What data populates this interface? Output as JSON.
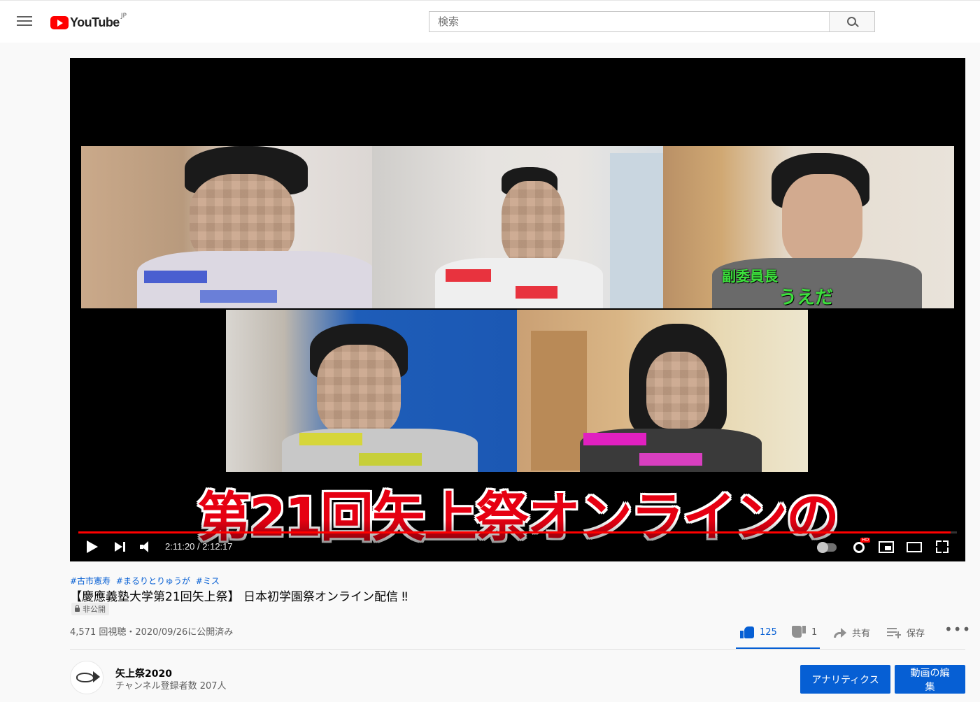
{
  "header": {
    "logo_text": "YouTube",
    "logo_region": "JP",
    "search_placeholder": "検索"
  },
  "player": {
    "overlay_labels": [
      "副委員長",
      "うえだ"
    ],
    "caption": "第21回矢上祭オンラインの",
    "time": "2:11:20 / 2:12:17",
    "progress_fraction": 0.993,
    "hd_badge": "HD"
  },
  "video": {
    "hashtags": [
      "#古市憲寿",
      "#まるりとりゅうが",
      "#ミス"
    ],
    "title": "【慶應義塾大学第21回矢上祭】 日本初学園祭オンライン配信 ‼",
    "privacy": "非公開",
    "meta": "4,571 回視聴・2020/09/26に公開済み"
  },
  "actions": {
    "likes": "125",
    "dislikes": "1",
    "share": "共有",
    "save": "保存",
    "more": "•••"
  },
  "channel": {
    "name": "矢上祭2020",
    "subscribers": "チャンネル登録者数 207人"
  },
  "buttons": {
    "analytics": "アナリティクス",
    "edit": "動画の編集"
  },
  "colors": {
    "accent": "#065fd4",
    "youtube_red": "#ff0000",
    "caption_red": "#e60012",
    "overlay_green": "#3de03d"
  }
}
